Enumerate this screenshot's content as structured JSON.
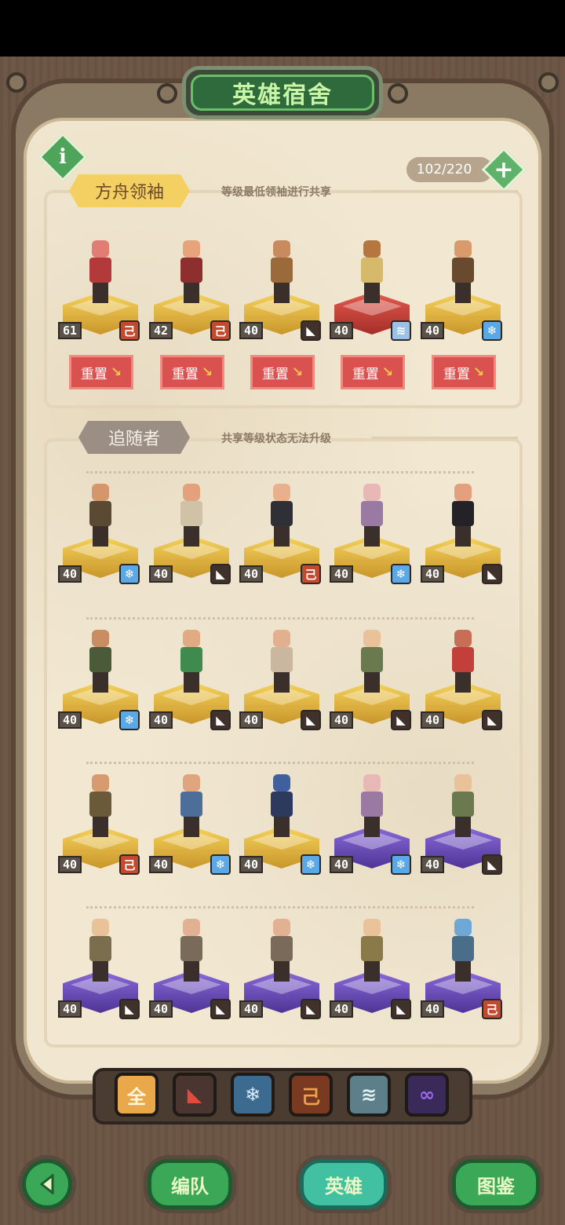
{
  "header": {
    "title": "英雄宿舍"
  },
  "capacity": {
    "text": "102/220"
  },
  "leaders": {
    "tag": "方舟领袖",
    "note": "等级最低领袖进行共享",
    "reset_label": "重置",
    "heroes": [
      {
        "level": "61",
        "faction": "red-faction",
        "pedestal": "gold",
        "skin": "#e27d74",
        "outfit": "#b23a3a"
      },
      {
        "level": "42",
        "faction": "red-faction",
        "pedestal": "gold",
        "skin": "#e6a37c",
        "outfit": "#8f2e2e"
      },
      {
        "level": "40",
        "faction": "dark-faction",
        "pedestal": "gold",
        "skin": "#c88b5d",
        "outfit": "#9a6a3a"
      },
      {
        "level": "40",
        "faction": "stripe-faction",
        "pedestal": "red",
        "skin": "#b5763f",
        "outfit": "#d7b96c"
      },
      {
        "level": "40",
        "faction": "ice-faction",
        "pedestal": "gold",
        "skin": "#d99a6c",
        "outfit": "#6a4a2f"
      }
    ]
  },
  "followers": {
    "tag": "追随者",
    "note": "共享等级状态无法升级",
    "heroes": [
      {
        "level": "40",
        "faction": "ice-faction",
        "pedestal": "gold",
        "skin": "#d4966a",
        "outfit": "#5b4a33"
      },
      {
        "level": "40",
        "faction": "dark-faction",
        "pedestal": "gold",
        "skin": "#e3a27b",
        "outfit": "#cfc2a6"
      },
      {
        "level": "40",
        "faction": "red-faction",
        "pedestal": "gold",
        "skin": "#e8b08c",
        "outfit": "#2f2f38"
      },
      {
        "level": "40",
        "faction": "ice-faction",
        "pedestal": "gold",
        "skin": "#e8b8b6",
        "outfit": "#9a7aa2"
      },
      {
        "level": "40",
        "faction": "dark-faction",
        "pedestal": "gold",
        "skin": "#e2a07e",
        "outfit": "#242226"
      },
      {
        "level": "40",
        "faction": "ice-faction",
        "pedestal": "gold",
        "skin": "#c98d63",
        "outfit": "#4b5a38"
      },
      {
        "level": "40",
        "faction": "dark-faction",
        "pedestal": "gold",
        "skin": "#e0ab82",
        "outfit": "#3f8a4f"
      },
      {
        "level": "40",
        "faction": "dark-faction",
        "pedestal": "gold",
        "skin": "#e3b08f",
        "outfit": "#c9b7a0"
      },
      {
        "level": "40",
        "faction": "dark-faction",
        "pedestal": "gold",
        "skin": "#eac29a",
        "outfit": "#6a7a4e"
      },
      {
        "level": "40",
        "faction": "dark-faction",
        "pedestal": "gold",
        "skin": "#c86e57",
        "outfit": "#c23f3a"
      },
      {
        "level": "40",
        "faction": "red-faction",
        "pedestal": "gold",
        "skin": "#d69b6f",
        "outfit": "#6a5a3a"
      },
      {
        "level": "40",
        "faction": "ice-faction",
        "pedestal": "gold",
        "skin": "#e0a57e",
        "outfit": "#4e6e9a"
      },
      {
        "level": "40",
        "faction": "ice-faction",
        "pedestal": "gold",
        "skin": "#3f5f9e",
        "outfit": "#2c3a5e"
      },
      {
        "level": "40",
        "faction": "ice-faction",
        "pedestal": "purple",
        "skin": "#e8b8b6",
        "outfit": "#9a7aa2"
      },
      {
        "level": "40",
        "faction": "dark-faction",
        "pedestal": "purple",
        "skin": "#eac29a",
        "outfit": "#6a7a4e"
      },
      {
        "level": "40",
        "faction": "dark-faction",
        "pedestal": "purple",
        "skin": "#eac29a",
        "outfit": "#7a6e4e"
      },
      {
        "level": "40",
        "faction": "dark-faction",
        "pedestal": "purple",
        "skin": "#e2b193",
        "outfit": "#7a6a5a"
      },
      {
        "level": "40",
        "faction": "dark-faction",
        "pedestal": "purple",
        "skin": "#e2b193",
        "outfit": "#7a6a5a"
      },
      {
        "level": "40",
        "faction": "dark-faction",
        "pedestal": "purple",
        "skin": "#eac29a",
        "outfit": "#8a7a4a"
      },
      {
        "level": "40",
        "faction": "red-faction",
        "pedestal": "purple",
        "skin": "#6fa7d6",
        "outfit": "#4a6e8a"
      }
    ]
  },
  "filters": [
    {
      "label": "全",
      "name": "filter-all",
      "bg": "#e9a94b",
      "fg": "#fff5dc"
    },
    {
      "label": "",
      "name": "filter-dark-faction",
      "bg": "#4a3530",
      "fg": "#e24a3c"
    },
    {
      "label": "",
      "name": "filter-ice-faction",
      "bg": "#3d6a8f",
      "fg": "#d6ecff"
    },
    {
      "label": "",
      "name": "filter-red-faction",
      "bg": "#7a3a22",
      "fg": "#f0a24a"
    },
    {
      "label": "",
      "name": "filter-stripe-faction",
      "bg": "#5d7f8a",
      "fg": "#e0f0f0"
    },
    {
      "label": "∞",
      "name": "filter-infinity",
      "bg": "#3a2a5a",
      "fg": "#9b6cf0"
    }
  ],
  "bottom_nav": {
    "team": "编队",
    "heroes": "英雄",
    "codex": "图鉴"
  },
  "faction_glyphs": {
    "red-faction": "己",
    "dark-faction": "◣",
    "ice-faction": "❄",
    "stripe-faction": "≋"
  }
}
